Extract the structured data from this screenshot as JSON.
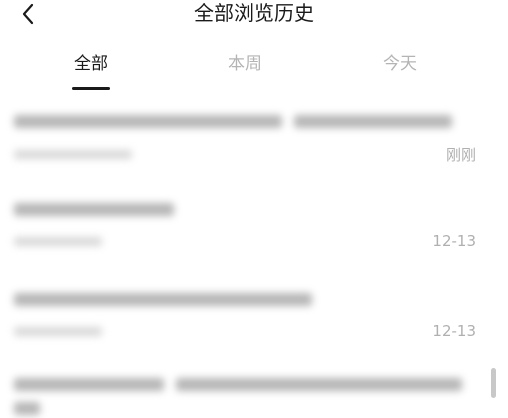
{
  "header": {
    "title": "全部浏览历史",
    "back_icon": "chevron-left-icon"
  },
  "tabs": [
    {
      "label": "全部",
      "active": true
    },
    {
      "label": "本周",
      "active": false
    },
    {
      "label": "今天",
      "active": false
    }
  ],
  "items": [
    {
      "time": "刚刚"
    },
    {
      "time": "12-13"
    },
    {
      "time": "12-13"
    },
    {
      "time": ""
    }
  ]
}
